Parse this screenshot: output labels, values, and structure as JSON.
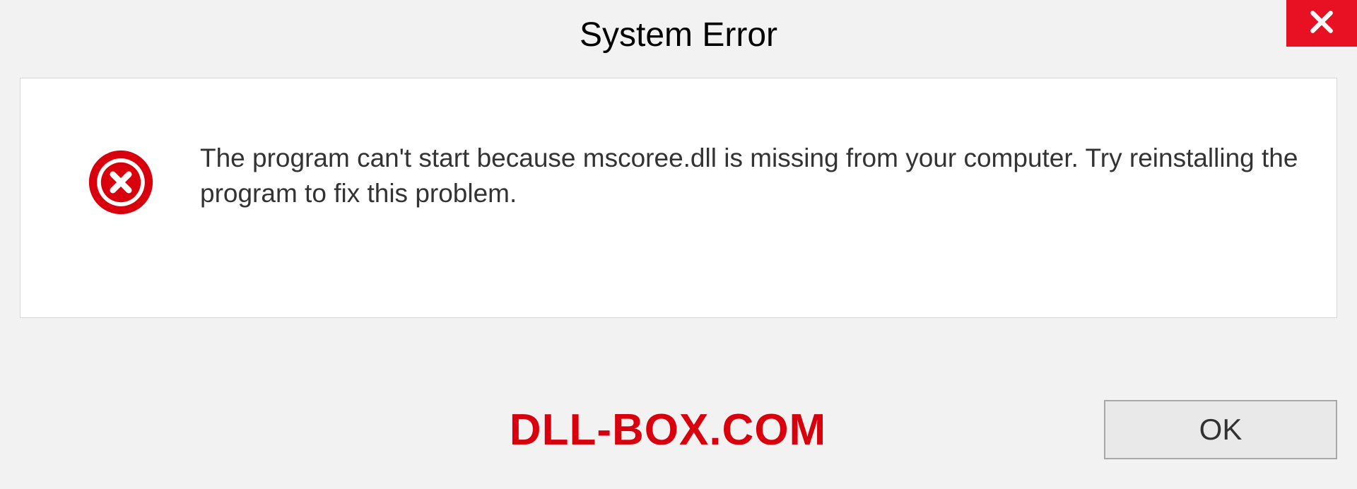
{
  "title": "System Error",
  "message": "The program can't start because mscoree.dll is missing from your computer. Try reinstalling the program to fix this problem.",
  "ok_label": "OK",
  "watermark": "DLL-BOX.COM",
  "colors": {
    "close_bg": "#e81123",
    "error_icon": "#d8000c",
    "watermark": "#d8000c"
  }
}
